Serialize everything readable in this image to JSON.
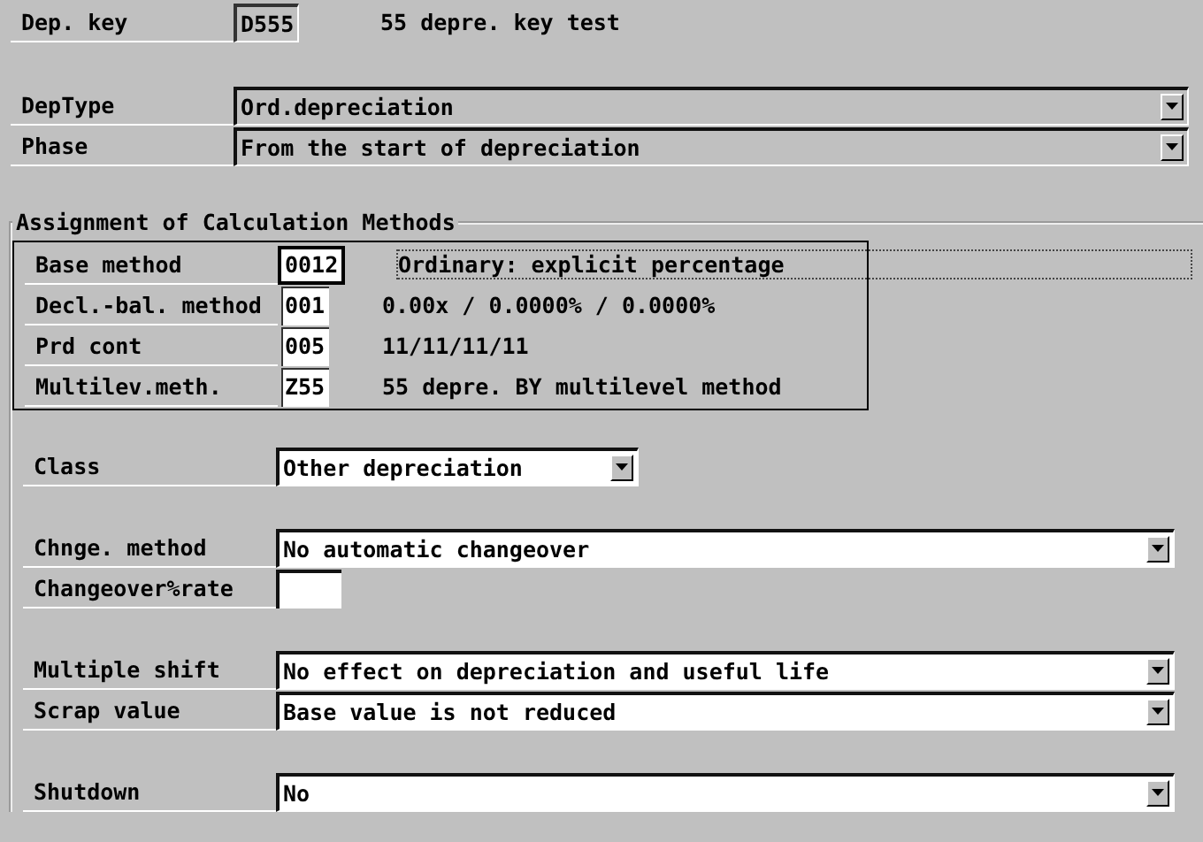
{
  "header": {
    "label": "Dep. key",
    "value": "D555",
    "description": "55 depre. key test"
  },
  "top_fields": [
    {
      "label": "DepType",
      "value": "Ord.depreciation"
    },
    {
      "label": "Phase",
      "value": "From the start of depreciation"
    }
  ],
  "group": {
    "title": "Assignment of Calculation Methods",
    "methods": [
      {
        "label": "Base method",
        "value": "0012",
        "description": "Ordinary: explicit percentage",
        "focused": true
      },
      {
        "label": "Decl.-bal. method",
        "value": "001",
        "description": "0.00x / 0.0000% / 0.0000%",
        "focused": false
      },
      {
        "label": "Prd cont",
        "value": "005",
        "description": "11/11/11/11",
        "focused": false
      },
      {
        "label": "Multilev.meth.",
        "value": "Z55",
        "description": "55 depre. BY multilevel method",
        "focused": false
      }
    ],
    "blocks": [
      [
        {
          "kind": "short-dropdown",
          "label": "Class",
          "value": "Other depreciation"
        }
      ],
      [
        {
          "kind": "dropdown",
          "label": "Chnge. method",
          "value": "No automatic changeover"
        },
        {
          "kind": "input",
          "label": "Changeover%rate"
        }
      ],
      [
        {
          "kind": "dropdown",
          "label": "Multiple shift",
          "value": "No effect on depreciation and useful life"
        },
        {
          "kind": "dropdown",
          "label": "Scrap value",
          "value": "Base value is not reduced"
        }
      ],
      [
        {
          "kind": "dropdown",
          "label": "Shutdown",
          "value": "No"
        }
      ]
    ]
  }
}
